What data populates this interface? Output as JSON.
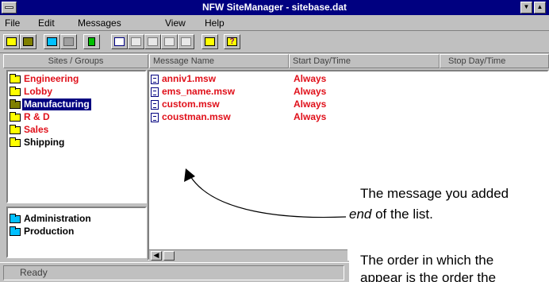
{
  "window": {
    "title": "NFW SiteManager - sitebase.dat",
    "min_glyph": "▼",
    "max_glyph": "▲"
  },
  "menu": {
    "items": [
      {
        "label": "File"
      },
      {
        "label": "Edit"
      },
      {
        "label": "Messages"
      },
      {
        "label": "View"
      },
      {
        "label": "Help"
      }
    ]
  },
  "toolbar": {
    "buttons": [
      {
        "icon": "open-folder-icon"
      },
      {
        "icon": "save-icon"
      },
      {
        "icon": "link-icon"
      },
      {
        "icon": "disconnect-icon"
      },
      {
        "icon": "trash-icon"
      },
      {
        "icon": "new-message-icon"
      },
      {
        "icon": "edit-icon"
      },
      {
        "icon": "copy-icon"
      },
      {
        "icon": "table-icon"
      },
      {
        "icon": "pen-icon"
      },
      {
        "icon": "schedule-icon"
      },
      {
        "icon": "help-icon"
      }
    ]
  },
  "columns": {
    "sites_groups": "Sites / Groups",
    "message_name": "Message Name",
    "start": "Start Day/Time",
    "stop": "Stop Day/Time"
  },
  "groups": [
    {
      "label": "Engineering",
      "color": "#e0101a",
      "selected": false
    },
    {
      "label": "Lobby",
      "color": "#e0101a",
      "selected": false
    },
    {
      "label": "Manufacturing",
      "color": "#ffffff",
      "selected": true
    },
    {
      "label": "R & D",
      "color": "#e0101a",
      "selected": false
    },
    {
      "label": "Sales",
      "color": "#e0101a",
      "selected": false
    },
    {
      "label": "Shipping",
      "color": "#000000",
      "selected": false
    }
  ],
  "distribution_lists": [
    {
      "label": "Administration"
    },
    {
      "label": "Production"
    }
  ],
  "messages": [
    {
      "name": "anniv1.msw",
      "start": "Always"
    },
    {
      "name": "ems_name.msw",
      "start": "Always"
    },
    {
      "name": "custom.msw",
      "start": "Always"
    },
    {
      "name": "coustman.msw",
      "start": "Always"
    }
  ],
  "status": {
    "text": "Ready"
  },
  "callout": {
    "line1": "The message you added",
    "line2_em": "end",
    "line2_rest": " of the list.",
    "line3": "The order in which the",
    "line4": "appear is the order the"
  }
}
